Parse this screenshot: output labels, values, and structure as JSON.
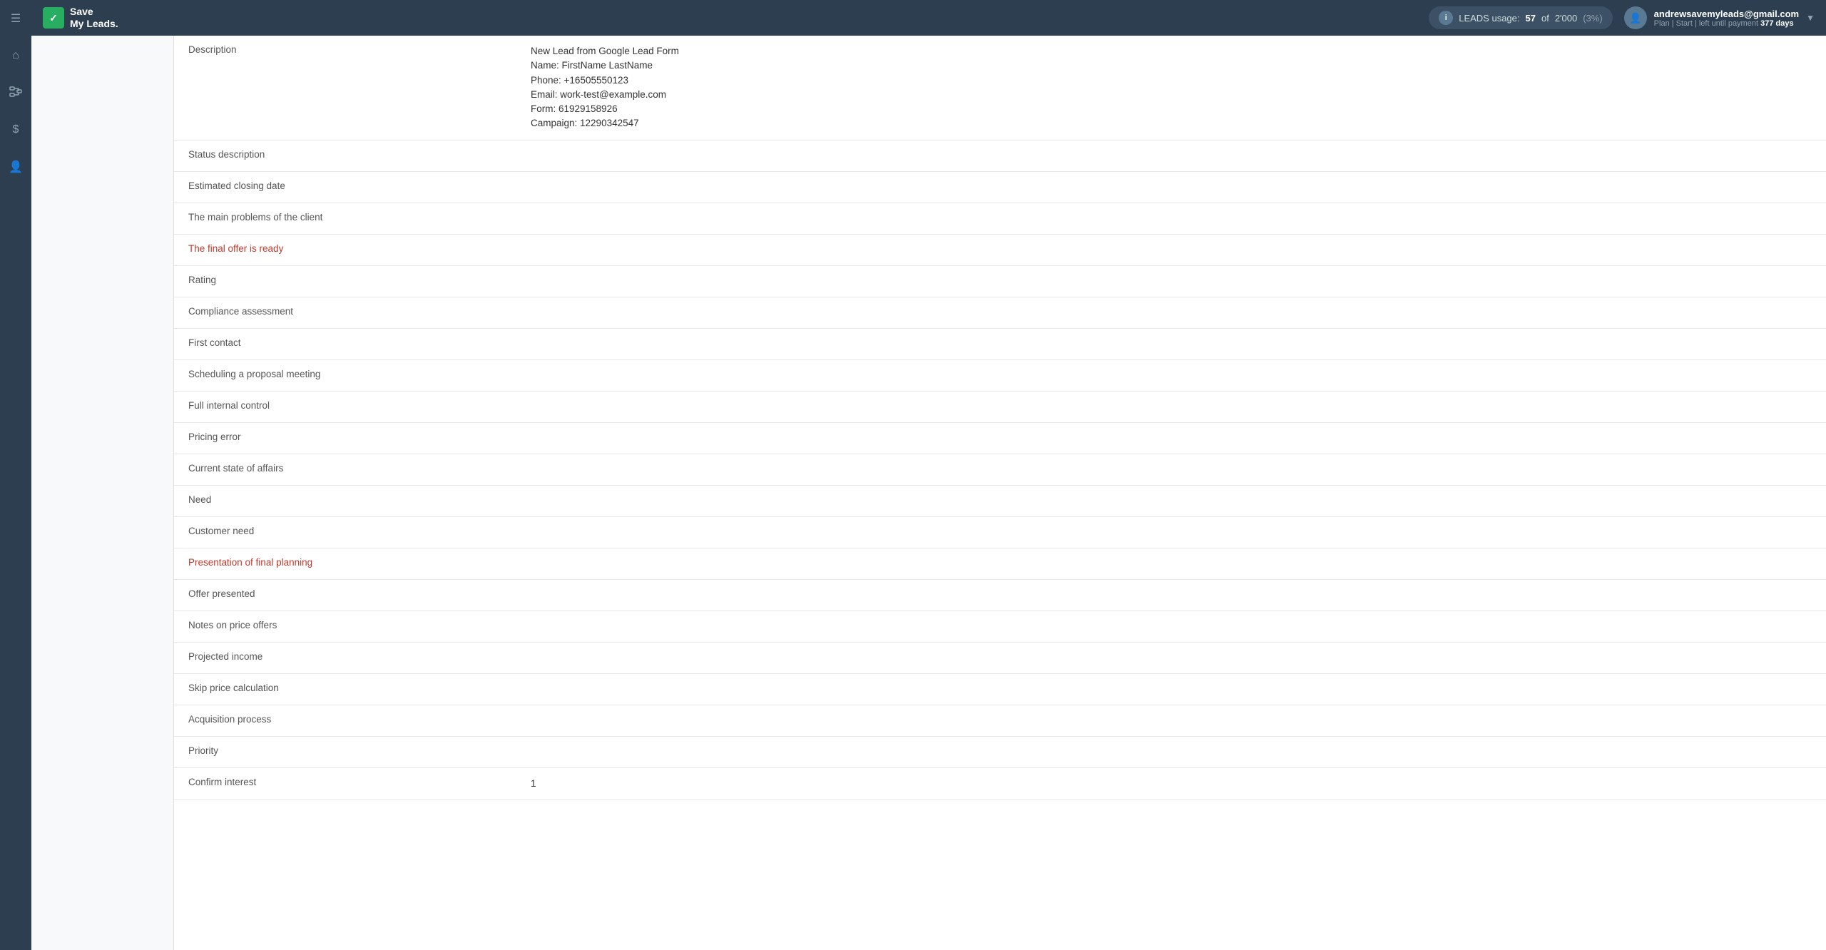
{
  "header": {
    "logo_line1": "Save",
    "logo_line2": "My Leads.",
    "logo_check": "✓",
    "leads_label": "LEADS usage:",
    "leads_used": "57",
    "leads_total": "2'000",
    "leads_pct": "(3%)",
    "user_email": "andrewsavemyleads@gmail.com",
    "user_plan": "Plan | Start | left until payment",
    "user_days": "377 days",
    "chevron": "▼"
  },
  "sidebar": {
    "items": [
      {
        "icon": "☰",
        "name": "menu-icon"
      },
      {
        "icon": "⌂",
        "name": "home-icon"
      },
      {
        "icon": "⚡",
        "name": "flows-icon"
      },
      {
        "icon": "$",
        "name": "billing-icon"
      },
      {
        "icon": "👤",
        "name": "profile-icon"
      }
    ]
  },
  "description": {
    "label": "Description",
    "lines": [
      "New Lead from Google Lead Form",
      "Name: FirstName LastName",
      "Phone: +16505550123",
      "Email: work-test@example.com",
      "Form: 61929158926",
      "Campaign: 12290342547"
    ]
  },
  "fields": [
    {
      "label": "Status description",
      "value": "",
      "highlighted": false
    },
    {
      "label": "Estimated closing date",
      "value": "",
      "highlighted": false
    },
    {
      "label": "The main problems of the client",
      "value": "",
      "highlighted": false
    },
    {
      "label": "The final offer is ready",
      "value": "",
      "highlighted": true
    },
    {
      "label": "Rating",
      "value": "",
      "highlighted": false
    },
    {
      "label": "Compliance assessment",
      "value": "",
      "highlighted": false
    },
    {
      "label": "First contact",
      "value": "",
      "highlighted": false
    },
    {
      "label": "Scheduling a proposal meeting",
      "value": "",
      "highlighted": false
    },
    {
      "label": "Full internal control",
      "value": "",
      "highlighted": false
    },
    {
      "label": "Pricing error",
      "value": "",
      "highlighted": false
    },
    {
      "label": "Current state of affairs",
      "value": "",
      "highlighted": false
    },
    {
      "label": "Need",
      "value": "",
      "highlighted": false
    },
    {
      "label": "Customer need",
      "value": "",
      "highlighted": false
    },
    {
      "label": "Presentation of final planning",
      "value": "",
      "highlighted": true
    },
    {
      "label": "Offer presented",
      "value": "",
      "highlighted": false
    },
    {
      "label": "Notes on price offers",
      "value": "",
      "highlighted": false
    },
    {
      "label": "Projected income",
      "value": "",
      "highlighted": false
    },
    {
      "label": "Skip price calculation",
      "value": "",
      "highlighted": false
    },
    {
      "label": "Acquisition process",
      "value": "",
      "highlighted": false
    },
    {
      "label": "Priority",
      "value": "",
      "highlighted": false
    },
    {
      "label": "Confirm interest",
      "value": "1",
      "highlighted": false
    }
  ]
}
